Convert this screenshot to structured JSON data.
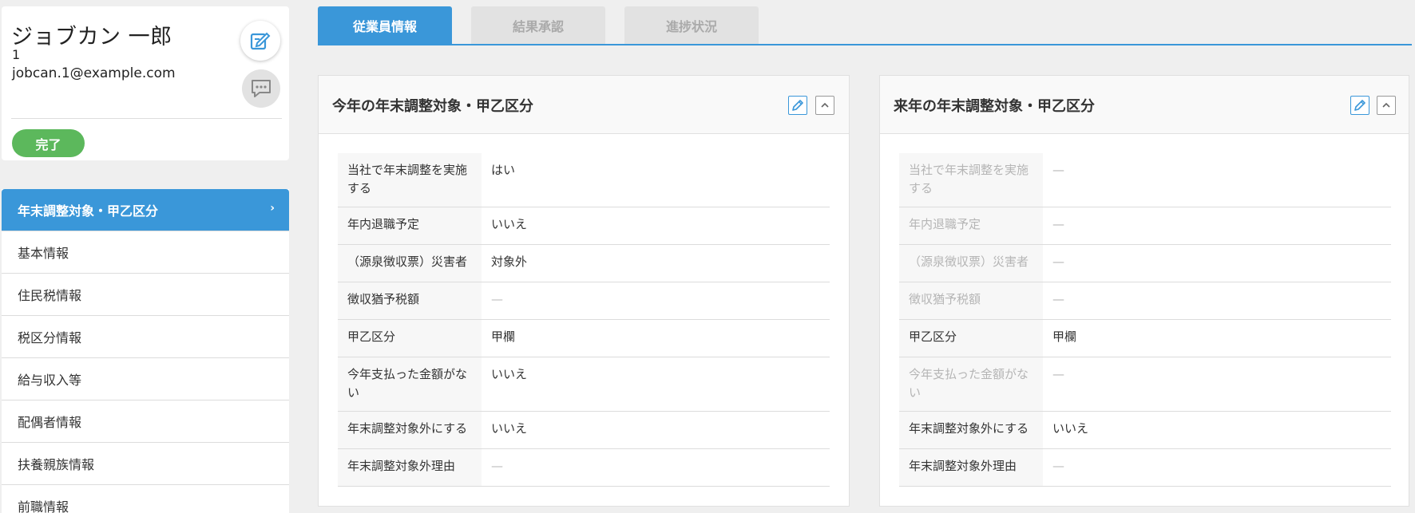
{
  "profile": {
    "name": "ジョブカン 一郎",
    "employee_id": "1",
    "email": "jobcan.1@example.com",
    "status": "完了",
    "status_color": "#5cb85c"
  },
  "nav": {
    "items": [
      {
        "label": "年末調整対象・甲乙区分",
        "active": true
      },
      {
        "label": "基本情報"
      },
      {
        "label": "住民税情報"
      },
      {
        "label": "税区分情報"
      },
      {
        "label": "給与収入等"
      },
      {
        "label": "配偶者情報"
      },
      {
        "label": "扶養親族情報"
      },
      {
        "label": "前職情報"
      }
    ],
    "chevron": "›"
  },
  "tabs": [
    {
      "label": "従業員情報",
      "active": true
    },
    {
      "label": "結果承認"
    },
    {
      "label": "進捗状況"
    }
  ],
  "panels": [
    {
      "title": "今年の年末調整対象・甲乙区分",
      "rows": [
        {
          "label": "当社で年末調整を実施する",
          "value": "はい"
        },
        {
          "label": "年内退職予定",
          "value": "いいえ"
        },
        {
          "label": "（源泉徴収票）災害者",
          "value": "対象外"
        },
        {
          "label": "徴収猶予税額",
          "value": "—"
        },
        {
          "label": "甲乙区分",
          "value": "甲欄"
        },
        {
          "label": "今年支払った金額がない",
          "value": "いいえ"
        },
        {
          "label": "年末調整対象外にする",
          "value": "いいえ"
        },
        {
          "label": "年末調整対象外理由",
          "value": "—"
        }
      ]
    },
    {
      "title": "来年の年末調整対象・甲乙区分",
      "rows": [
        {
          "label": "当社で年末調整を実施する",
          "value": "—"
        },
        {
          "label": "年内退職予定",
          "value": "—"
        },
        {
          "label": "（源泉徴収票）災害者",
          "value": "—"
        },
        {
          "label": "徴収猶予税額",
          "value": "—"
        },
        {
          "label": "甲乙区分",
          "value": "甲欄"
        },
        {
          "label": "今年支払った金額がない",
          "value": "—"
        },
        {
          "label": "年末調整対象外にする",
          "value": "いいえ"
        },
        {
          "label": "年末調整対象外理由",
          "value": "—"
        }
      ]
    }
  ],
  "colors": {
    "accent": "#3a97d9",
    "success": "#5cb85c",
    "background": "#efefef"
  },
  "icons": {
    "edit_profile": "edit-icon",
    "message": "chat-icon",
    "panel_edit": "pencil-icon",
    "collapse": "chevron-up-icon"
  }
}
